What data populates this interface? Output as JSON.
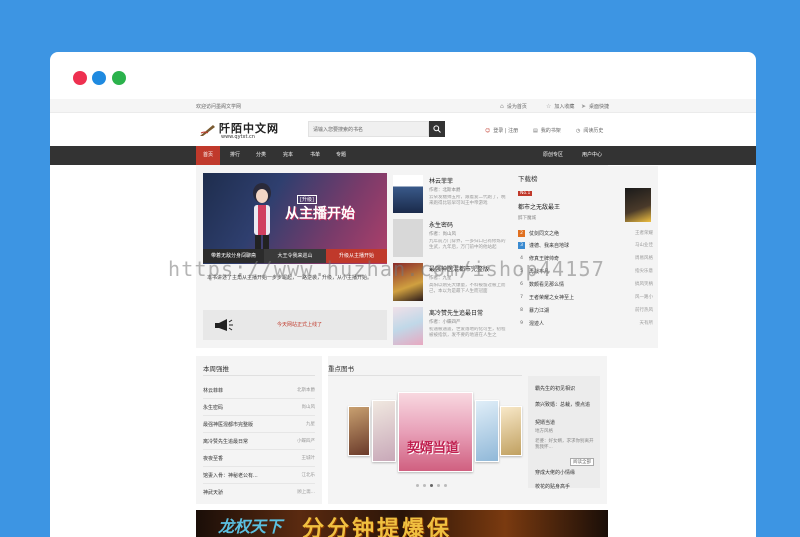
{
  "topbar": {
    "welcome": "欢迎访问墨阁文学网",
    "links": [
      "设为首页",
      "加入收藏",
      "桌面快捷"
    ]
  },
  "header": {
    "logo_cn": "阡陌中文网",
    "logo_url": "www.qytxt.cn",
    "search_placeholder": "请输入您要搜索的书名",
    "user_links": [
      "登录 | 注册",
      "我的书架",
      "阅读历史"
    ]
  },
  "nav": {
    "items": [
      "首页",
      "排行",
      "分类",
      "完本",
      "书单",
      "专题"
    ],
    "right_items": [
      "原创专区",
      "用户中心"
    ]
  },
  "banner": {
    "title": "从主播开始",
    "subtitle": "[升级]",
    "tabs": [
      "带着无敌分身闯聊斋",
      "大王令我来巡山",
      "升级从主播开始"
    ],
    "blurb": "本书讲述了主角从主播开始一步步崛起，一路逆袭，升级，从小主播开始。",
    "notice": "今天网站正式上线了"
  },
  "featured_books": [
    {
      "title": "林云菲菲",
      "author": "作者：北斯本爵",
      "desc": "云朵发糖帅五所，跟着爱二代跑了，晚来跑得比较早可叫王中帝游戏"
    },
    {
      "title": "永生密码",
      "author": "作者：尚山风",
      "desc": "九年前万门穿界，一多归口已有修炼的生武，九年后，万门前中的他站起"
    },
    {
      "title": "最强神医混都市完整版",
      "author": "作者：九星",
      "desc": "高阳以刚先大爆量，不料被留过被上而己，本以为是最下人生而冠面"
    },
    {
      "title": "离冷赞先生追最日常",
      "author": "作者：小蝶四严",
      "desc": "初遇被遇遥，世爱落地的化可生，初程被被指氛，发不要的地道在人生之"
    }
  ],
  "downloads": {
    "heading": "下载榜",
    "top": {
      "badge": "No.1",
      "title": "都市之无敌最王",
      "author": "醉下魔城"
    },
    "items": [
      {
        "n": "2",
        "title": "仗剑同文之绝",
        "author": "王者荣耀"
      },
      {
        "n": "3",
        "title": "谨德、我来自地球",
        "author": "马山业佳"
      },
      {
        "n": "4",
        "title": "修真王牌帅奇",
        "author": "周易风格"
      },
      {
        "n": "5",
        "title": "再战不凡",
        "author": "指尖乐意"
      },
      {
        "n": "6",
        "title": "数颇看见那么情",
        "author": "搞风笑柄"
      },
      {
        "n": "7",
        "title": "王者荣耀之女神至上",
        "author": "风一路小"
      },
      {
        "n": "8",
        "title": "暴力江湖",
        "author": "前行热风"
      },
      {
        "n": "9",
        "title": "混迹人",
        "author": "天有所"
      }
    ]
  },
  "weekly": {
    "heading": "本周强推",
    "items": [
      {
        "title": "林云菲菲",
        "author": "北斯本爵"
      },
      {
        "title": "永生密码",
        "author": "尚山风"
      },
      {
        "title": "最强神医混都市完整版",
        "author": "九星"
      },
      {
        "title": "离冷赞先生追最日常",
        "author": "小蝶四严"
      },
      {
        "title": "夜夜至香",
        "author": "王城叶"
      },
      {
        "title": "馆妻入骨：神秘老公有...",
        "author": "江北乐"
      },
      {
        "title": "神武天骄",
        "author": "顾上斋..."
      }
    ]
  },
  "focus": {
    "heading": "重点图书",
    "cover_caption": "契婿当道",
    "side": {
      "t1": "霸先生的初见相识",
      "t2": "萧兴致婚：总裁，慢点追",
      "t3": "契婿当道",
      "t3_author": "地方风格",
      "t3_desc": "老婆：好女婿，求求你别离开我我怀...",
      "read": "阅读全部",
      "t4": "穿成大佬的小情缘",
      "t5": "校花的贴身高手"
    }
  },
  "ad": {
    "logo": "龙权天下",
    "slogan": "分分钟提爆保"
  },
  "watermark": "https://www.huzhan.com/ishop44157",
  "colors": {
    "background": "#3d95e3",
    "nav": "#333333",
    "accent": "#c0392b",
    "dot_red": "#ee3050",
    "dot_blue": "#1f8ae0",
    "dot_green": "#2bb24c"
  }
}
